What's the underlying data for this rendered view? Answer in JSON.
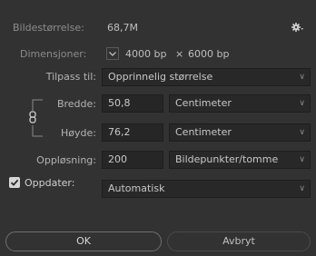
{
  "image_size": {
    "label": "Bildestørrelse:",
    "value": "68,7M"
  },
  "settings_icon": "gear-icon",
  "dimensions": {
    "label": "Dimensjoner:",
    "width": "4000 bp",
    "times": "×",
    "height": "6000 bp"
  },
  "fit_to": {
    "label": "Tilpass til:",
    "selected": "Opprinnelig størrelse"
  },
  "width": {
    "label": "Bredde:",
    "value": "50,8",
    "unit": "Centimeter"
  },
  "height": {
    "label": "Høyde:",
    "value": "76,2",
    "unit": "Centimeter"
  },
  "resolution": {
    "label": "Oppløsning:",
    "value": "200",
    "unit": "Bildepunkter/tomme"
  },
  "resample": {
    "label": "Oppdater:",
    "checked": true,
    "selected": "Automatisk"
  },
  "buttons": {
    "ok": "OK",
    "cancel": "Avbryt"
  }
}
